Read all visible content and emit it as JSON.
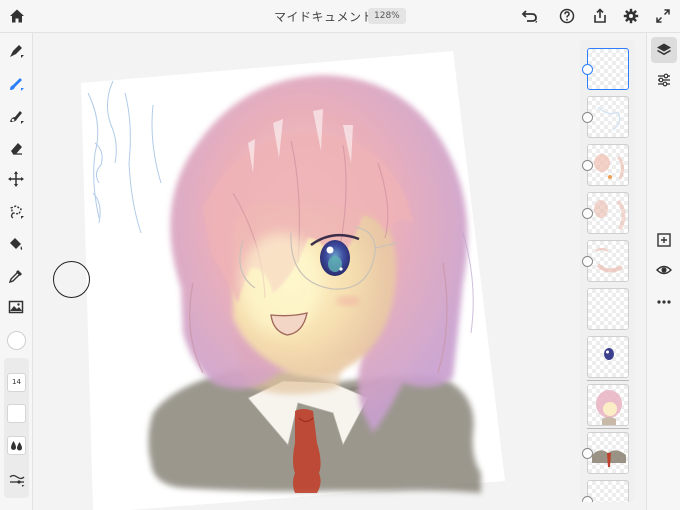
{
  "topbar": {
    "title": "マイドキュメント",
    "zoom": "128%",
    "icons": [
      "home-icon",
      "undo-icon",
      "help-icon",
      "share-icon",
      "settings-icon",
      "fullscreen-icon"
    ]
  },
  "left_toolbar": {
    "tools": [
      "pixel-brush-icon",
      "live-brush-icon",
      "vector-brush-icon",
      "eraser-icon",
      "move-icon",
      "lasso-icon",
      "fill-icon",
      "eyedropper-icon",
      "image-icon"
    ],
    "active_tool": "live-brush-icon",
    "current_color": "#ffffff",
    "brush_size": "14"
  },
  "layers": {
    "count": 10,
    "selected_index": 0,
    "layer_names": []
  },
  "right_rail": {
    "icons": [
      "layers-icon",
      "properties-icon",
      "add-layer-icon",
      "visibility-icon",
      "more-icon"
    ]
  },
  "colors": {
    "accent": "#2d7ff9",
    "hair": "#e9aeb9",
    "coat": "#7f7a6e",
    "tie": "#c0412c",
    "eye": "#3b3f8e"
  }
}
